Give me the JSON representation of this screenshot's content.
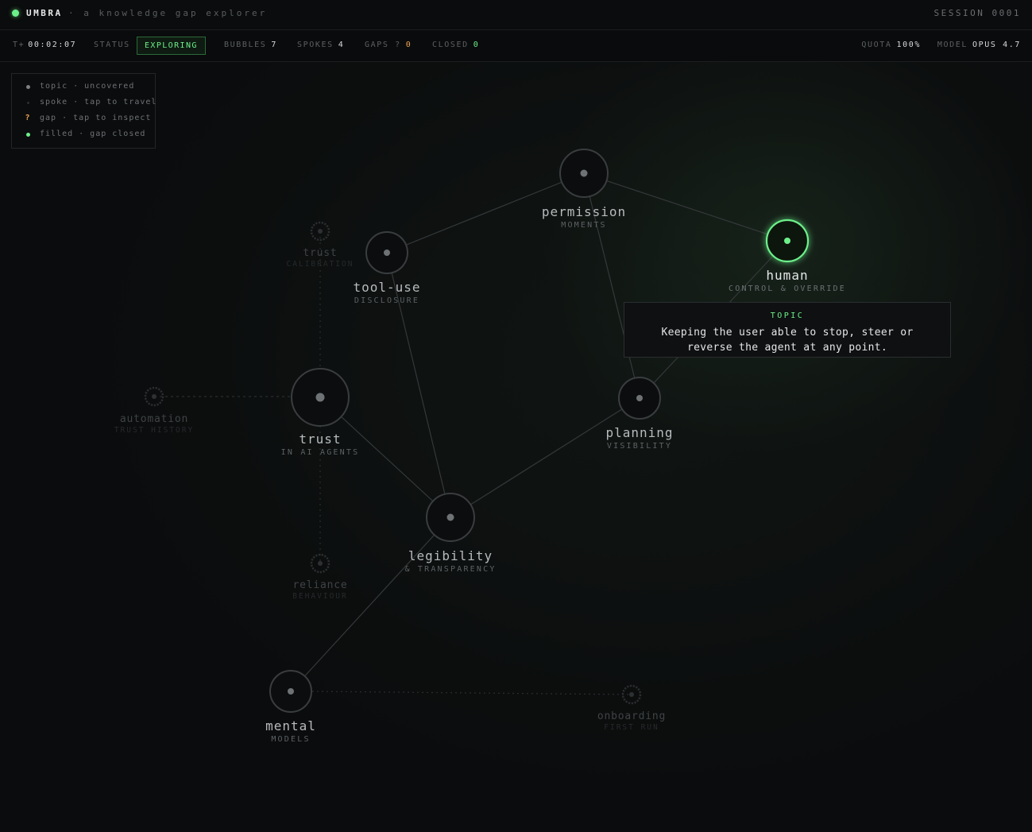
{
  "header": {
    "brand": "UMBRA",
    "tagline": "· a knowledge gap explorer",
    "session": "SESSION 0001"
  },
  "status_bar": {
    "timer_key": "T+",
    "timer_value": "00:02:07",
    "status_key": "STATUS",
    "status_value": "EXPLORING",
    "bubbles_key": "BUBBLES",
    "bubbles_value": "7",
    "spokes_key": "SPOKES",
    "spokes_value": "4",
    "gaps_key": "GAPS ?",
    "gaps_value": "0",
    "closed_key": "CLOSED",
    "closed_value": "0",
    "quota_key": "QUOTA",
    "quota_value": "100%",
    "model_key": "MODEL",
    "model_value": "OPUS 4.7",
    "accent_color": "#6cf08a",
    "gap_color": "#e8a456"
  },
  "legend": {
    "items": [
      {
        "icon": "topic-dot-icon",
        "label": "topic · uncovered"
      },
      {
        "icon": "spoke-dot-icon",
        "label": "spoke · tap to travel"
      },
      {
        "icon": "gap-question-icon",
        "symbol": "?",
        "label": "gap · tap to inspect"
      },
      {
        "icon": "filled-dot-icon",
        "label": "filled · gap closed"
      }
    ]
  },
  "graph": {
    "nodes": [
      {
        "id": "permission",
        "name": "permission",
        "sub": "MOMENTS"
      },
      {
        "id": "human",
        "name": "human",
        "sub": "CONTROL & OVERRIDE",
        "active": true
      },
      {
        "id": "tool-use",
        "name": "tool-use",
        "sub": "DISCLOSURE"
      },
      {
        "id": "trust",
        "name": "trust",
        "sub": "IN AI AGENTS"
      },
      {
        "id": "planning",
        "name": "planning",
        "sub": "VISIBILITY"
      },
      {
        "id": "legibility",
        "name": "legibility",
        "sub": "& TRANSPARENCY"
      },
      {
        "id": "mental",
        "name": "mental",
        "sub": "MODELS"
      }
    ],
    "spokes": [
      {
        "id": "trust-calibration",
        "name": "trust",
        "sub": "CALIBRATION"
      },
      {
        "id": "automation",
        "name": "automation",
        "sub": "TRUST HISTORY"
      },
      {
        "id": "reliance",
        "name": "reliance",
        "sub": "BEHAVIOUR"
      },
      {
        "id": "onboarding",
        "name": "onboarding",
        "sub": "FIRST RUN"
      }
    ]
  },
  "tooltip": {
    "kicker": "TOPIC",
    "body": "Keeping the user able to stop, steer or reverse the agent at any point."
  }
}
